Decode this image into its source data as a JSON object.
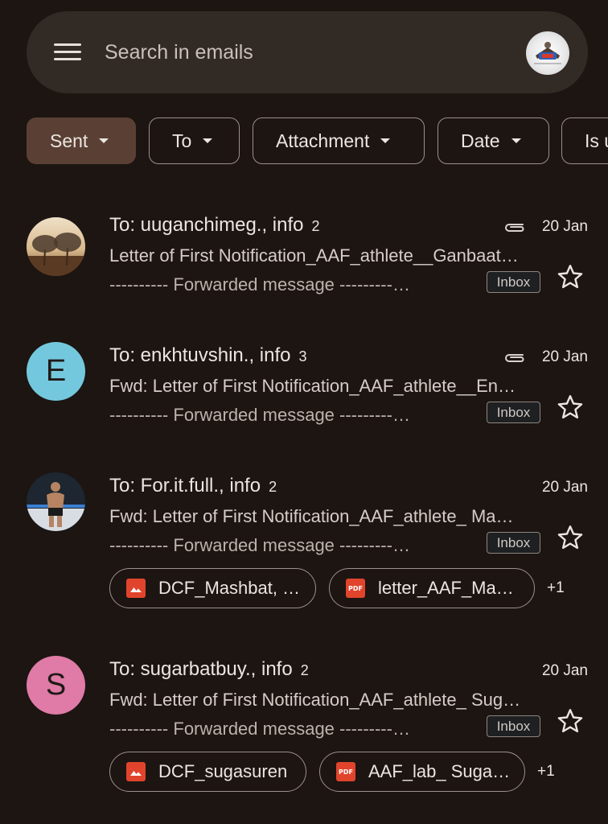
{
  "search": {
    "placeholder": "Search in emails"
  },
  "filters": [
    {
      "label": "Sent",
      "selected": true
    },
    {
      "label": "To"
    },
    {
      "label": "Attachment"
    },
    {
      "label": "Date"
    },
    {
      "label": "Is u"
    }
  ],
  "emails": [
    {
      "sender": "To: uuganchimeg., info",
      "count": "2",
      "date": "20 Jan",
      "has_attachment_icon": true,
      "subject": "Letter of First Notification_AAF_athlete__Ganbaat…",
      "snippet": "---------- Forwarded message ---------…",
      "label": "Inbox"
    },
    {
      "sender": "To: enkhtuvshin., info",
      "count": "3",
      "avatar_letter": "E",
      "date": "20 Jan",
      "has_attachment_icon": true,
      "subject": "Fwd: Letter of First Notification_AAF_athlete__En…",
      "snippet": "---------- Forwarded message ---------…",
      "label": "Inbox"
    },
    {
      "sender": "To: For.it.full., info",
      "count": "2",
      "date": "20 Jan",
      "subject": "Fwd: Letter of First Notification_AAF_athlete_ Ma…",
      "snippet": "---------- Forwarded message ---------…",
      "label": "Inbox",
      "attachments": [
        {
          "name": "DCF_Mashbat, …",
          "type": "image"
        },
        {
          "name": "letter_AAF_Ma…",
          "type": "pdf"
        }
      ],
      "more_attachments": "+1"
    },
    {
      "sender": "To: sugarbatbuy., info",
      "count": "2",
      "avatar_letter": "S",
      "date": "20 Jan",
      "subject": "Fwd: Letter of First Notification_AAF_athlete_ Sug…",
      "snippet": "---------- Forwarded message ---------…",
      "label": "Inbox",
      "attachments": [
        {
          "name": "DCF_sugasuren",
          "type": "image"
        },
        {
          "name": "AAF_lab_ Suga…",
          "type": "pdf"
        }
      ],
      "more_attachments": "+1"
    }
  ],
  "icons": {
    "menu": "menu-icon",
    "attachment": "paperclip-icon",
    "star": "star-outline-icon",
    "image": "image-file-icon",
    "pdf": "pdf-file-icon"
  },
  "icon_labels": {
    "pdf": "PDF"
  },
  "colors": {
    "background": "#1c1512",
    "search_bar": "#322a25",
    "selected_chip": "#5a4034",
    "avatar_e": "#74c8dd",
    "avatar_s": "#e07aa6",
    "file_icon": "#e0442c"
  }
}
